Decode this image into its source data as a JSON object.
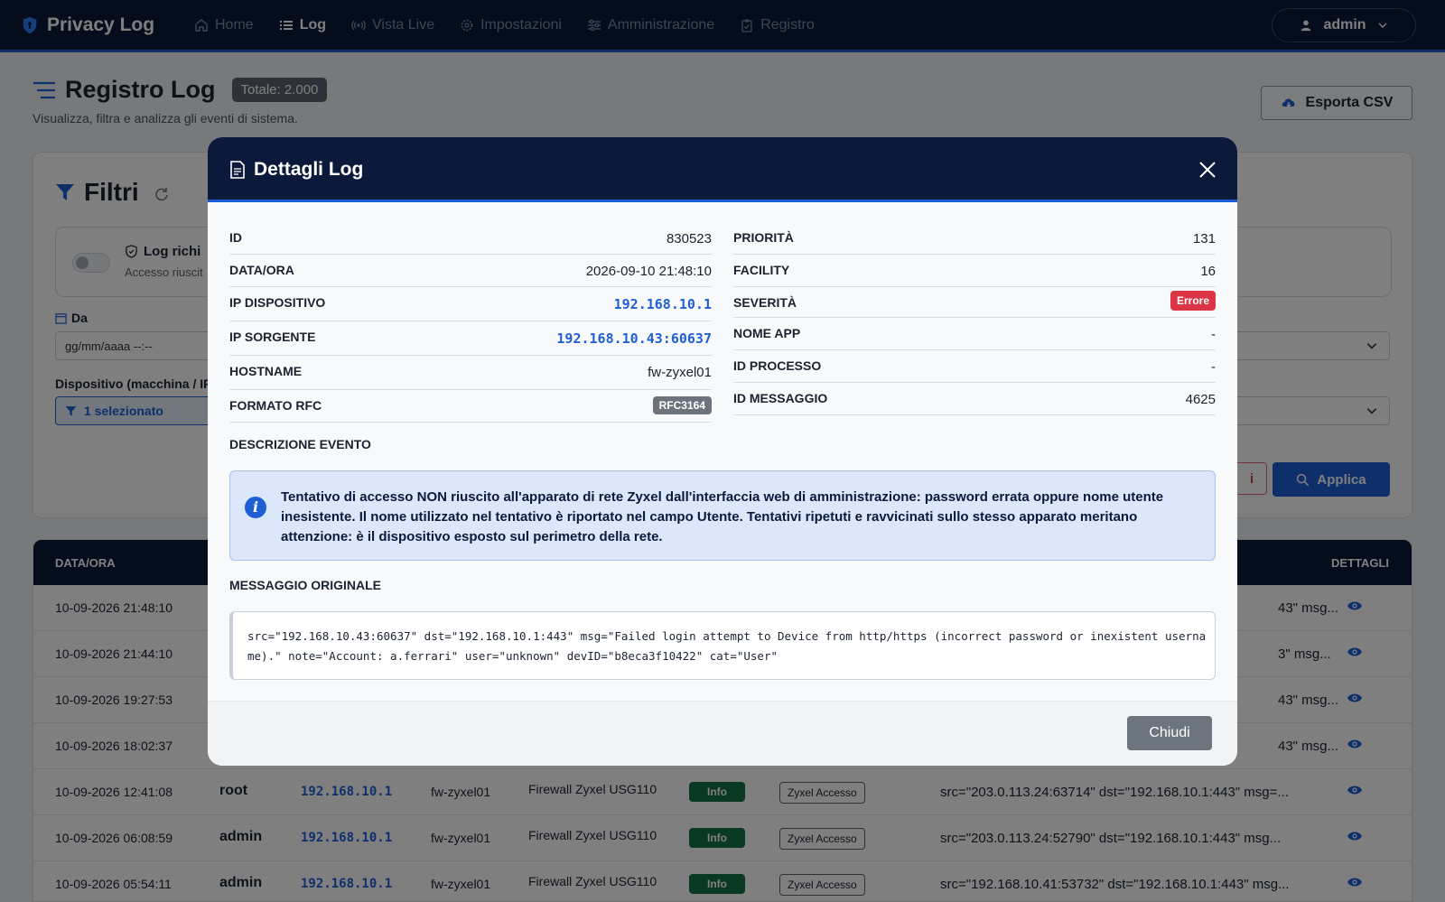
{
  "navbar": {
    "brand": "Privacy Log",
    "links": [
      {
        "label": "Home",
        "icon": "home-icon",
        "active": false
      },
      {
        "label": "Log",
        "icon": "list-icon",
        "active": true
      },
      {
        "label": "Vista Live",
        "icon": "broadcast-icon",
        "active": false
      },
      {
        "label": "Impostazioni",
        "icon": "gear-icon",
        "active": false
      },
      {
        "label": "Amministrazione",
        "icon": "sliders-icon",
        "active": false
      },
      {
        "label": "Registro",
        "icon": "clipboard-icon",
        "active": false
      }
    ],
    "user": "admin"
  },
  "page": {
    "title": "Registro Log",
    "total_badge": "Totale: 2.000",
    "subtitle": "Visualizza, filtra e analizza gli eventi di sistema.",
    "export_label": "Esporta CSV"
  },
  "filters": {
    "title": "Filtri",
    "toggle_label": "Log richi",
    "toggle_sub": "Accesso riuscit",
    "da_label": "Da",
    "da_placeholder": "gg/mm/aaaa --:--",
    "device_label": "Dispositivo (macchina / IP",
    "device_selected": "1 selezionato",
    "reset_label": "i",
    "apply_label": "Applica"
  },
  "table": {
    "headers": {
      "date": "DATA/ORA",
      "details": "DETTAGLI"
    },
    "rows": [
      {
        "date": "10-09-2026 21:48:10",
        "msg_tail": "43\" msg..."
      },
      {
        "date": "10-09-2026 21:44:10",
        "msg_tail": "3\" msg..."
      },
      {
        "date": "10-09-2026 19:27:53",
        "msg_tail": "43\" msg..."
      },
      {
        "date": "10-09-2026 18:02:37",
        "msg_tail": "43\" msg..."
      },
      {
        "date": "10-09-2026 12:41:08",
        "user": "root",
        "ip": "192.168.10.1",
        "host": "fw-zyxel01",
        "device": "Firewall Zyxel USG110",
        "severity": "Info",
        "category": "Zyxel Accesso",
        "msg": "src=\"203.0.113.24:63714\" dst=\"192.168.10.1:443\" msg=..."
      },
      {
        "date": "10-09-2026 06:08:59",
        "user": "admin",
        "ip": "192.168.10.1",
        "host": "fw-zyxel01",
        "device": "Firewall Zyxel USG110",
        "severity": "Info",
        "category": "Zyxel Accesso",
        "msg": "src=\"203.0.113.24:52790\" dst=\"192.168.10.1:443\" msg..."
      },
      {
        "date": "10-09-2026 05:54:11",
        "user": "admin",
        "ip": "192.168.10.1",
        "host": "fw-zyxel01",
        "device": "Firewall Zyxel USG110",
        "severity": "Info",
        "category": "Zyxel Accesso",
        "msg": "src=\"192.168.10.41:53732\" dst=\"192.168.10.1:443\" msg..."
      }
    ]
  },
  "modal": {
    "title": "Dettagli Log",
    "left": [
      {
        "key": "ID",
        "value": "830523"
      },
      {
        "key": "DATA/ORA",
        "value": "2026-09-10 21:48:10"
      },
      {
        "key": "IP DISPOSITIVO",
        "value": "192.168.10.1"
      },
      {
        "key": "IP SORGENTE",
        "value": "192.168.10.43:60637"
      },
      {
        "key": "HOSTNAME",
        "value": "fw-zyxel01"
      },
      {
        "key": "FORMATO RFC",
        "value": "RFC3164"
      }
    ],
    "right": [
      {
        "key": "PRIORITÀ",
        "value": "131"
      },
      {
        "key": "FACILITY",
        "value": "16"
      },
      {
        "key": "SEVERITÀ",
        "value": "Errore"
      },
      {
        "key": "NOME APP",
        "value": "-"
      },
      {
        "key": "ID PROCESSO",
        "value": "-"
      },
      {
        "key": "ID MESSAGGIO",
        "value": "4625"
      }
    ],
    "desc_title": "DESCRIZIONE EVENTO",
    "description": "Tentativo di accesso NON riuscito all'apparato di rete Zyxel dall'interfaccia web di amministrazione: password errata oppure nome utente inesistente. Il nome utilizzato nel tentativo è riportato nel campo Utente. Tentativi ripetuti e ravvicinati sullo stesso apparato meritano attenzione: è il dispositivo esposto sul perimetro della rete.",
    "raw_title": "MESSAGGIO ORIGINALE",
    "raw": "src=\"192.168.10.43:60637\" dst=\"192.168.10.1:443\" msg=\"Failed login attempt to Device from http/https (incorrect password or inexistent username).\" note=\"Account: a.ferrari\" user=\"unknown\" devID=\"b8eca3f10422\" cat=\"User\"",
    "close_label": "Chiudi"
  },
  "colors": {
    "navy": "#0b1a3a",
    "accent": "#1f5fd6",
    "error": "#dc3545",
    "info": "#157347"
  }
}
